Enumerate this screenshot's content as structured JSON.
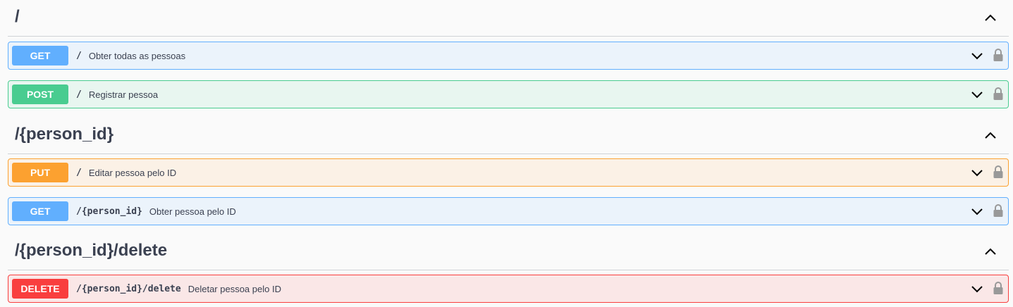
{
  "colors": {
    "get": "#61affe",
    "post": "#49cc90",
    "put": "#fca130",
    "delete": "#f93e3e"
  },
  "sections": [
    {
      "title": "/",
      "toggle_icon": "chevron-up-icon",
      "operations": [
        {
          "method": "GET",
          "path": "/",
          "summary": "Obter todas as pessoas"
        },
        {
          "method": "POST",
          "path": "/",
          "summary": "Registrar pessoa"
        }
      ]
    },
    {
      "title": "/{person_id}",
      "toggle_icon": "chevron-up-icon",
      "operations": [
        {
          "method": "PUT",
          "path": "/",
          "summary": "Editar pessoa pelo ID"
        },
        {
          "method": "GET",
          "path": "/{person_id}",
          "summary": "Obter pessoa pelo ID"
        }
      ]
    },
    {
      "title": "/{person_id}/delete",
      "toggle_icon": "chevron-up-icon",
      "operations": [
        {
          "method": "DELETE",
          "path": "/{person_id}/delete",
          "summary": "Deletar pessoa pelo ID"
        }
      ]
    }
  ],
  "icons": {
    "expand": "chevron-down-icon",
    "auth": "lock-icon"
  }
}
